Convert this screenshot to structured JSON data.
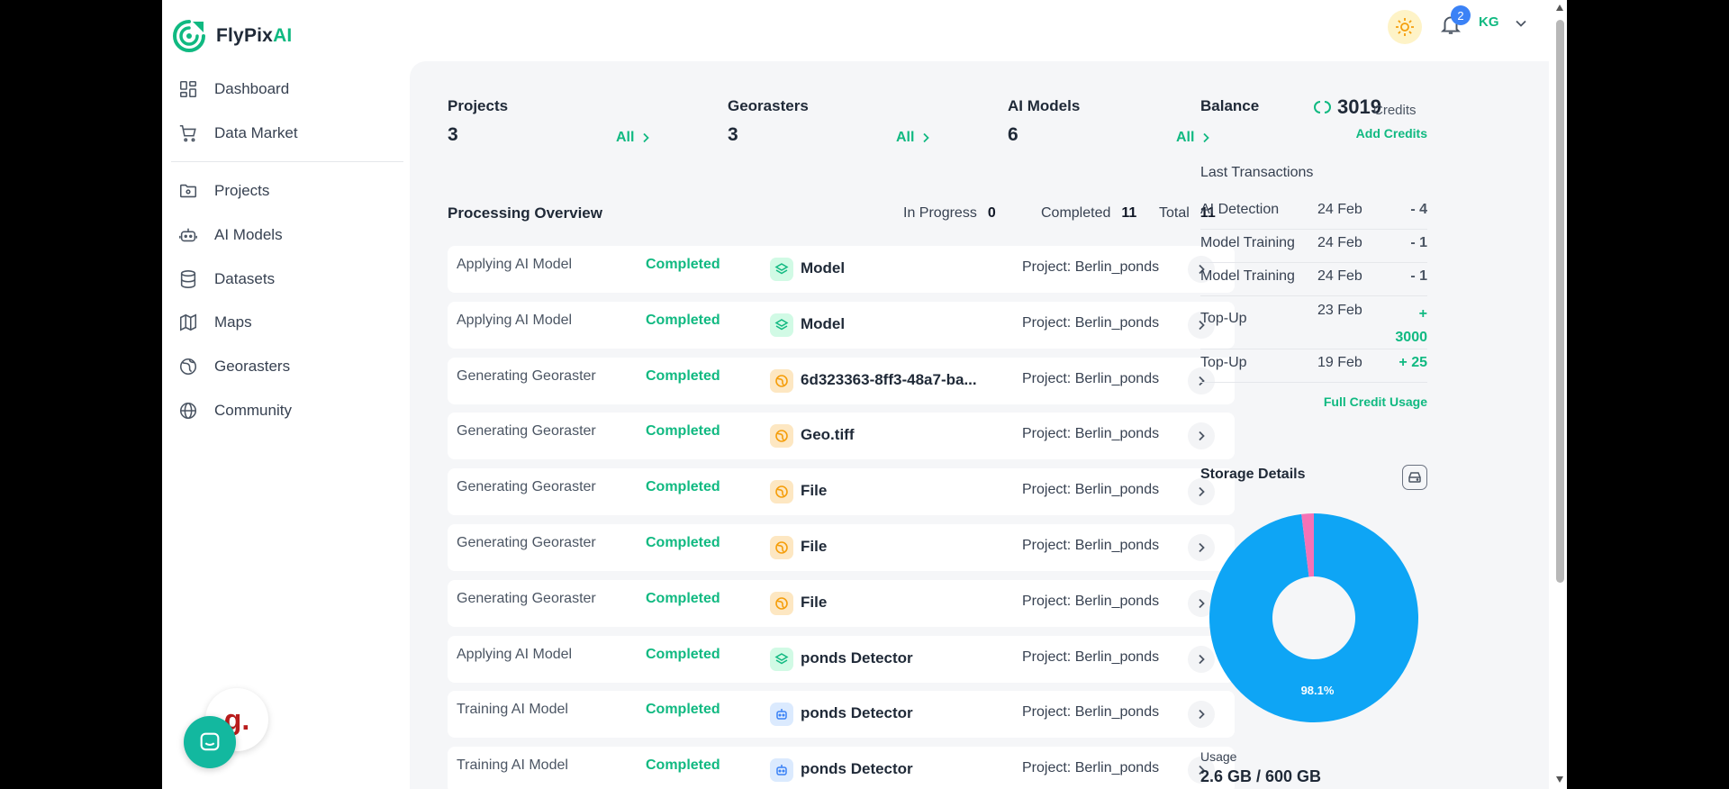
{
  "brand": {
    "name": "FlyPix",
    "accent": "AI",
    "accent_color": "#10b981"
  },
  "sidebar": {
    "items": [
      {
        "label": "Dashboard",
        "icon": "dashboard-icon"
      },
      {
        "label": "Data Market",
        "icon": "cart-icon"
      },
      {
        "label": "Projects",
        "icon": "folder-icon"
      },
      {
        "label": "AI Models",
        "icon": "robot-icon"
      },
      {
        "label": "Datasets",
        "icon": "database-icon"
      },
      {
        "label": "Maps",
        "icon": "map-icon"
      },
      {
        "label": "Georasters",
        "icon": "globe-grid-icon"
      },
      {
        "label": "Community",
        "icon": "globe-icon"
      }
    ],
    "gorgias_label": "g."
  },
  "header": {
    "notifications_count": "2",
    "user_initials": "KG"
  },
  "stats": [
    {
      "label": "Projects",
      "value": "3",
      "link": "All"
    },
    {
      "label": "Georasters",
      "value": "3",
      "link": "All"
    },
    {
      "label": "AI Models",
      "value": "6",
      "link": "All"
    }
  ],
  "processing": {
    "title": "Processing Overview",
    "in_progress_label": "In Progress",
    "in_progress": "0",
    "completed_label": "Completed",
    "completed": "11",
    "total_label": "Total",
    "total": "11",
    "rows": [
      {
        "op": "Applying AI Model",
        "status": "Completed",
        "kind": "model",
        "name": "Model",
        "project": "Project: Berlin_ponds"
      },
      {
        "op": "Applying AI Model",
        "status": "Completed",
        "kind": "model",
        "name": "Model",
        "project": "Project: Berlin_ponds"
      },
      {
        "op": "Generating Georaster",
        "status": "Completed",
        "kind": "geo",
        "name": "6d323363-8ff3-48a7-ba...",
        "project": "Project: Berlin_ponds"
      },
      {
        "op": "Generating Georaster",
        "status": "Completed",
        "kind": "geo",
        "name": "Geo.tiff",
        "project": "Project: Berlin_ponds"
      },
      {
        "op": "Generating Georaster",
        "status": "Completed",
        "kind": "geo",
        "name": "File",
        "project": "Project: Berlin_ponds"
      },
      {
        "op": "Generating Georaster",
        "status": "Completed",
        "kind": "geo",
        "name": "File",
        "project": "Project: Berlin_ponds"
      },
      {
        "op": "Generating Georaster",
        "status": "Completed",
        "kind": "geo",
        "name": "File",
        "project": "Project: Berlin_ponds"
      },
      {
        "op": "Applying AI Model",
        "status": "Completed",
        "kind": "model",
        "name": "ponds Detector",
        "project": "Project: Berlin_ponds"
      },
      {
        "op": "Training AI Model",
        "status": "Completed",
        "kind": "train",
        "name": "ponds Detector",
        "project": "Project: Berlin_ponds"
      },
      {
        "op": "Training AI Model",
        "status": "Completed",
        "kind": "train",
        "name": "ponds Detector",
        "project": "Project: Berlin_ponds"
      }
    ]
  },
  "balance": {
    "label": "Balance",
    "value": "3019",
    "unit": "Credits",
    "add_credits": "Add Credits",
    "last_transactions_title": "Last Transactions",
    "transactions": [
      {
        "name": "AI Detection",
        "date": "24 Feb",
        "amount": "- 4",
        "sign": "neg"
      },
      {
        "name": "Model Training",
        "date": "24 Feb",
        "amount": "- 1",
        "sign": "neg"
      },
      {
        "name": "Model Training",
        "date": "24 Feb",
        "amount": "- 1",
        "sign": "neg"
      },
      {
        "name": "Top-Up",
        "date": "23 Feb",
        "amount": "+ 3000",
        "sign": "pos"
      },
      {
        "name": "Top-Up",
        "date": "19 Feb",
        "amount": "+ 25",
        "sign": "pos"
      }
    ],
    "full_usage": "Full Credit Usage"
  },
  "storage": {
    "title": "Storage Details",
    "used_percent": 98.1,
    "used_percent_label": "98.1%",
    "colors": {
      "main": "#0ea5f5",
      "secondary": "#f472b6"
    },
    "usage_label": "Usage",
    "usage_value": "2.6 GB / 600 GB"
  }
}
